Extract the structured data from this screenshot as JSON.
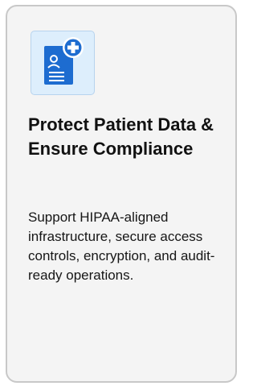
{
  "card": {
    "icon": "patient-data-protection-icon",
    "icon_colors": {
      "tile": "#ddeefc",
      "document": "#1d6cd0",
      "badge": "#1d6cd0"
    },
    "title": "Protect Patient Data & Ensure Compliance",
    "description": "Support HIPAA-aligned infrastructure, secure access controls, encryption, and audit-ready operations."
  }
}
